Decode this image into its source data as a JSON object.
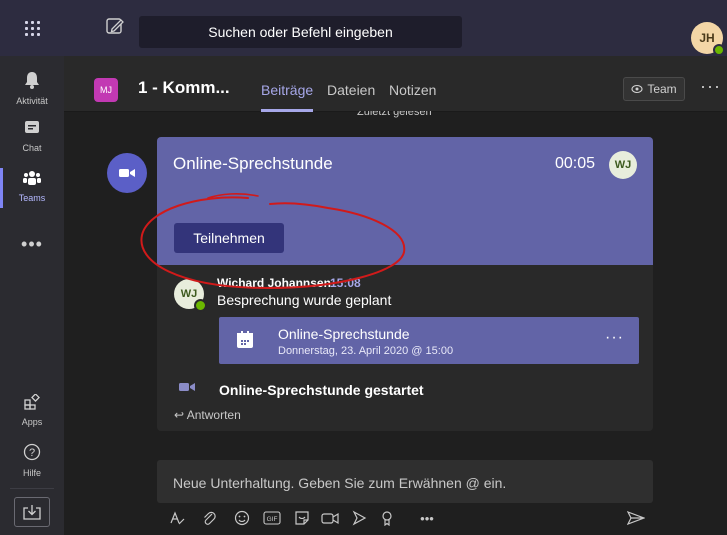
{
  "topbar": {
    "search_placeholder": "Suchen oder Befehl eingeben",
    "user_initials": "JH"
  },
  "rail": {
    "items": [
      {
        "label": "Aktivität",
        "icon": "bell-icon"
      },
      {
        "label": "Chat",
        "icon": "chat-icon"
      },
      {
        "label": "Teams",
        "icon": "teams-icon",
        "active": true
      },
      {
        "label": "Apps",
        "icon": "apps-icon"
      },
      {
        "label": "Hilfe",
        "icon": "help-icon"
      }
    ]
  },
  "channel": {
    "team_initials": "MJ",
    "title": "1 - Komm...",
    "tabs": [
      "Beiträge",
      "Dateien",
      "Notizen"
    ],
    "team_button": "Team"
  },
  "feed": {
    "last_read": "Zuletzt gelesen",
    "meeting": {
      "title": "Online-Sprechstunde",
      "timer": "00:05",
      "avatar_initials": "WJ",
      "join_label": "Teilnehmen"
    },
    "reply": {
      "avatar_initials": "WJ",
      "author": "Wichard Johannsen",
      "time": "15:08",
      "message": "Besprechung wurde geplant",
      "event_title": "Online-Sprechstunde",
      "event_date": "Donnerstag, 23. April 2020 @ 15:00"
    },
    "started": "Online-Sprechstunde gestartet",
    "reply_link": "Antworten"
  },
  "compose": {
    "placeholder": "Neue Unterhaltung. Geben Sie zum Erwähnen @ ein."
  },
  "colors": {
    "accent": "#6264a7",
    "topbar": "#2d2c40",
    "annotation": "#d11a1a"
  }
}
